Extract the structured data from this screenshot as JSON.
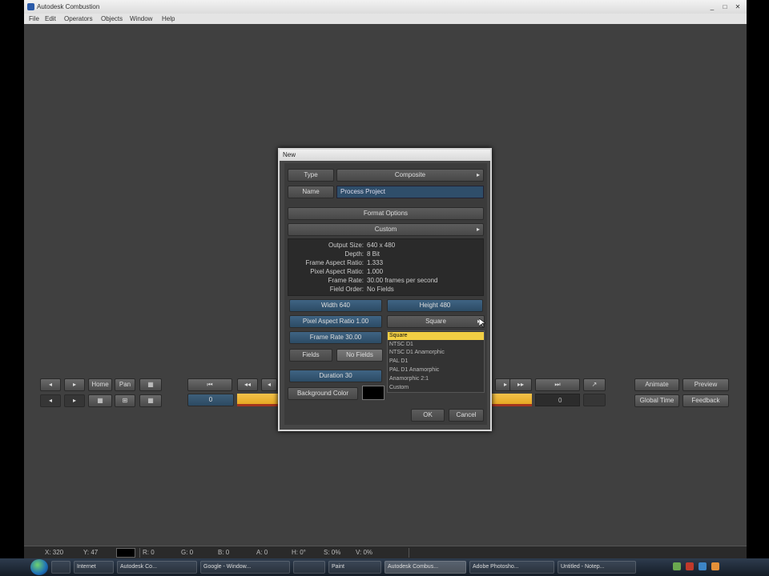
{
  "window": {
    "title": "Autodesk Combustion",
    "controls": [
      "_",
      "□",
      "✕"
    ]
  },
  "menu": [
    "File",
    "Edit",
    "Operators",
    "Objects",
    "Window",
    "Help"
  ],
  "controlbar": {
    "left_top": [
      "◂",
      "▸",
      "Home",
      "Pan",
      "▦"
    ],
    "left_bottom": [
      "◂",
      "▸",
      "▦",
      "⊞",
      "▦"
    ],
    "transport_left": [
      "⏮",
      "◂◂",
      "◂"
    ],
    "transport_right": [
      "▸",
      "▸▸",
      "⏭",
      "↗"
    ],
    "frame_value": "0",
    "frame_value_right": "0",
    "right_top": [
      "Animate",
      "Preview"
    ],
    "right_bottom": [
      "Global Time",
      "Feedback"
    ]
  },
  "dialog": {
    "title": "New",
    "type_label": "Type",
    "type_value": "Composite",
    "name_label": "Name",
    "name_value": "Process Project",
    "format_options": "Format Options",
    "format_preset": "Custom",
    "info": [
      {
        "label": "Output Size:",
        "value": "640 x 480"
      },
      {
        "label": "Depth:",
        "value": "8 Bit"
      },
      {
        "label": "Frame Aspect Ratio:",
        "value": "1.333"
      },
      {
        "label": "Pixel Aspect Ratio:",
        "value": "1.000"
      },
      {
        "label": "Frame Rate:",
        "value": "30.00 frames per second"
      },
      {
        "label": "Field Order:",
        "value": "No Fields"
      }
    ],
    "width_btn": "Width 640",
    "height_btn": "Height 480",
    "pixel_aspect_btn": "Pixel Aspect Ratio 1.00",
    "pixel_aspect_preset": "Square",
    "frame_rate_btn": "Frame Rate 30.00",
    "fields_label": "Fields",
    "fields_value": "No Fields",
    "duration_btn": "Duration 30",
    "background_color_btn": "Background Color",
    "ok": "OK",
    "cancel": "Cancel",
    "dropdown_items": [
      "Square",
      "NTSC D1",
      "NTSC D1 Anamorphic",
      "PAL D1",
      "PAL D1 Anamorphic",
      "Anamorphic 2:1",
      "Custom"
    ],
    "dropdown_selected": "Square"
  },
  "statusbar": {
    "cells": [
      "X: 320",
      "Y: 47",
      "R: 0",
      "G: 0",
      "B: 0",
      "A: 0",
      "H: 0°",
      "S: 0%",
      "V: 0%"
    ]
  },
  "taskbar": {
    "items": [
      "",
      "Internet",
      "Autodesk Co...",
      "Google - Window...",
      "",
      "Paint",
      "Autodesk Combus...",
      "Adobe Photosho...",
      "Untitled - Notep..."
    ],
    "active_index": 6
  },
  "colors": {
    "app_bg": "#404040",
    "timeline_yellow": "#f0b833",
    "dropdown_highlight": "#f2cf44",
    "blue_button": "#2f4e6a"
  }
}
